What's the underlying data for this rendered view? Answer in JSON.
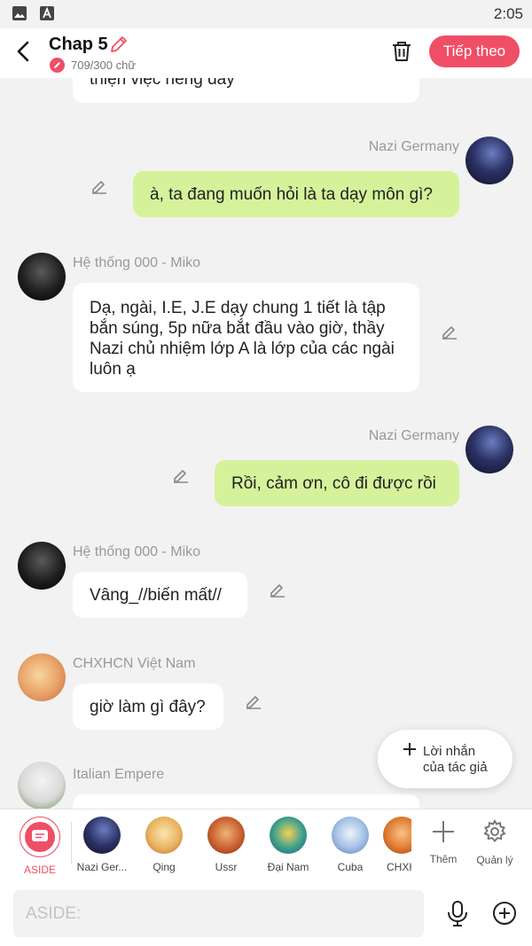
{
  "statusbar": {
    "time": "2:05",
    "icons": [
      "image-icon",
      "a-icon"
    ]
  },
  "appbar": {
    "title": "Chap 5",
    "word_count": "709/300 chữ",
    "next_label": "Tiếp theo"
  },
  "messages": [
    {
      "side": "left",
      "sender": "",
      "text": "thiện việc riêng đây",
      "editable": false
    },
    {
      "side": "right",
      "sender": "Nazi Germany",
      "text": "à, ta đang muốn hỏi là ta dạy môn gì?",
      "editable": true
    },
    {
      "side": "left",
      "sender": "Hệ thống 000 - Miko",
      "text": "Dạ, ngài, I.E, J.E dạy chung 1 tiết là tập bắn súng, 5p nữa bắt đầu vào giờ, thầy Nazi chủ nhiệm lớp A là lớp của các ngài luôn ạ",
      "editable": true
    },
    {
      "side": "right",
      "sender": "Nazi Germany",
      "text": "Rồi, cảm ơn, cô đi được rồi",
      "editable": true
    },
    {
      "side": "left",
      "sender": "Hệ thống 000 - Miko",
      "text": "Vâng_//biến mất//",
      "editable": true
    },
    {
      "side": "left",
      "sender": "CHXHCN Việt Nam",
      "text": "giờ làm gì đây?",
      "editable": true
    },
    {
      "side": "left",
      "sender": "Italian Empere",
      "text": "",
      "editable": false
    }
  ],
  "fab": {
    "label_line1": "Lời nhắn",
    "label_line2": "của tác giả"
  },
  "characters": [
    {
      "name": "ASIDE",
      "accent": "#ef4f66"
    },
    {
      "name": "Nazi Ger...",
      "accent": "#2a2f55"
    },
    {
      "name": "Qing",
      "accent": "#e9b460"
    },
    {
      "name": "Ussr",
      "accent": "#c8612f"
    },
    {
      "name": "Đại Nam",
      "accent": "#3b9e8c"
    },
    {
      "name": "Cuba",
      "accent": "#7aa6d8"
    },
    {
      "name": "CHXH",
      "accent": "#e07a2f"
    }
  ],
  "tools": {
    "more_label": "Thêm",
    "manage_label": "Quản lý"
  },
  "input": {
    "placeholder": "ASIDE:"
  }
}
